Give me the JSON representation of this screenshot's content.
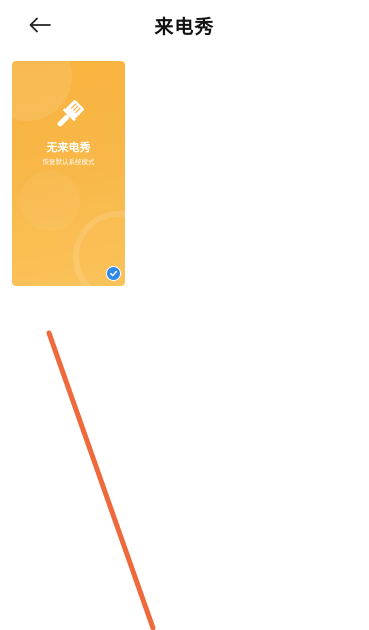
{
  "header": {
    "back_icon": "arrow-left-icon",
    "title": "来电秀"
  },
  "themes": [
    {
      "title": "无来电秀",
      "subtitle": "恢复默认系统模式",
      "icon": "paint-brush-icon",
      "selected": true,
      "accent_color": "#f9b33f",
      "check_color": "#2e8ae6"
    }
  ],
  "annotation": {
    "color": "#ee6a3d"
  }
}
